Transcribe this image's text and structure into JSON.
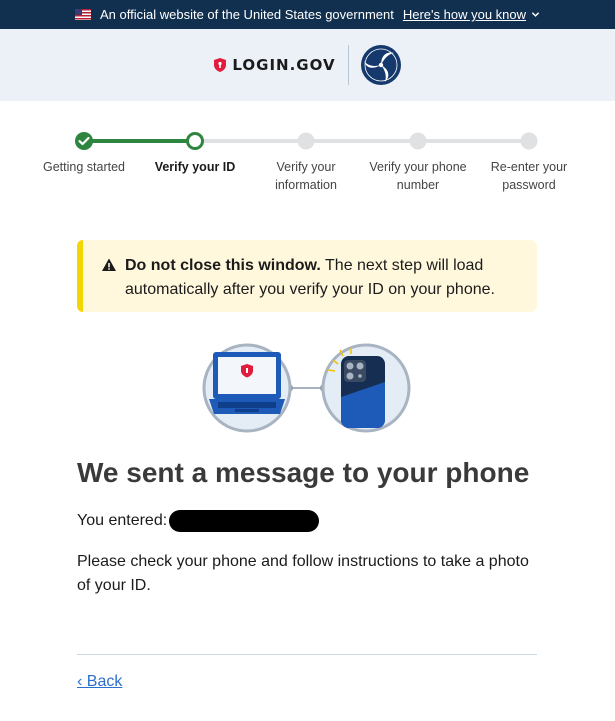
{
  "gov_banner": {
    "text": "An official website of the United States government",
    "link": "Here's how you know"
  },
  "header": {
    "logo_text": "LOGIN.GOV"
  },
  "steps": [
    {
      "label": "Getting started",
      "status": "complete"
    },
    {
      "label": "Verify your ID",
      "status": "current"
    },
    {
      "label": "Verify your information",
      "status": "incomplete"
    },
    {
      "label": "Verify your phone number",
      "status": "incomplete"
    },
    {
      "label": "Re-enter your password",
      "status": "incomplete"
    }
  ],
  "alert": {
    "bold": "Do not close this window.",
    "text": " The next step will load automatically after you verify your ID on your phone."
  },
  "page": {
    "title": "We sent a message to your phone",
    "entered_label": "You entered:",
    "instructions": "Please check your phone and follow instructions to take a photo of your ID.",
    "back": "‹ Back"
  },
  "colors": {
    "banner_bg": "#112f4e",
    "header_bg": "#ecf1f7",
    "step_complete": "#2e8540",
    "alert_bg": "#fff8dd",
    "alert_border": "#f2d600",
    "link": "#2c6fcc"
  }
}
